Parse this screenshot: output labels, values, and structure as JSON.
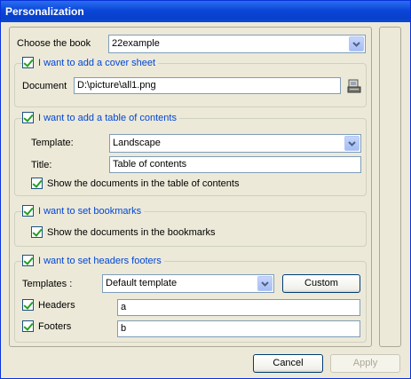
{
  "window": {
    "title": "Personalization"
  },
  "book": {
    "label": "Choose the book",
    "value": "22example"
  },
  "cover": {
    "checkbox_label": "I want to add a cover sheet",
    "checked": true,
    "document_label": "Document",
    "document_value": "D:\\picture\\all1.png",
    "browse_icon": "file-browse-icon"
  },
  "toc": {
    "checkbox_label": "I want to add a table of contents",
    "checked": true,
    "template_label": "Template:",
    "template_value": "Landscape",
    "title_label": "Title:",
    "title_value": "Table of contents",
    "show_docs_label": "Show the documents in the table of contents",
    "show_docs_checked": true
  },
  "bookmarks": {
    "checkbox_label": "I want to set bookmarks",
    "checked": true,
    "show_docs_label": "Show the documents in the bookmarks",
    "show_docs_checked": true
  },
  "headers_footers": {
    "checkbox_label": "I want to set headers  footers",
    "checked": true,
    "templates_label": "Templates :",
    "templates_value": "Default template",
    "custom_label": "Custom",
    "headers_label": "Headers",
    "headers_checked": true,
    "headers_value": "a",
    "footers_label": "Footers",
    "footers_checked": true,
    "footers_value": "b"
  },
  "buttons": {
    "cancel": "Cancel",
    "apply": "Apply"
  },
  "colors": {
    "title_bar": "#0a46d8",
    "group_label": "#0046d5",
    "check_mark": "#21a121"
  }
}
